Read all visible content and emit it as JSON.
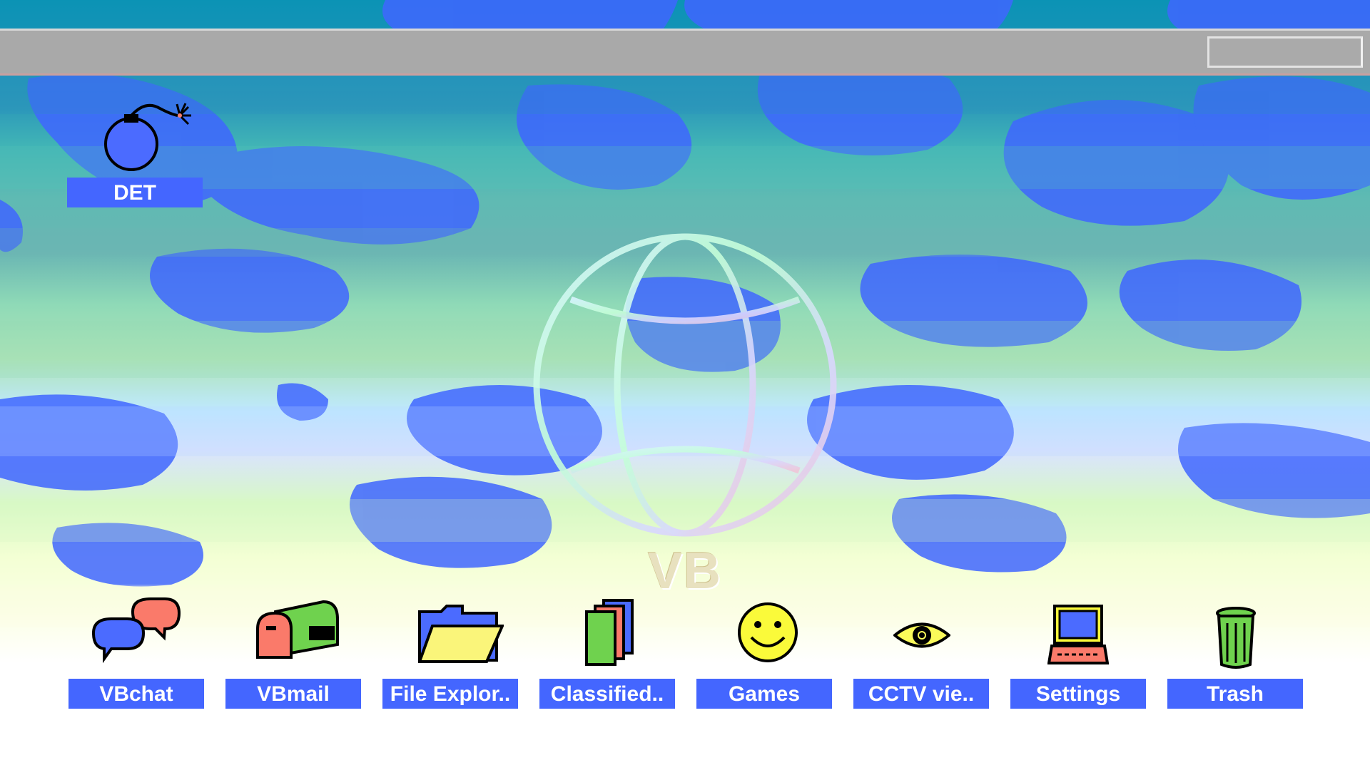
{
  "desktop_icons": [
    {
      "label": "DET",
      "icon": "bomb-icon"
    }
  ],
  "watermark": {
    "text": "VB",
    "icon": "globe-icon"
  },
  "dock": [
    {
      "label": "VBchat",
      "icon": "chat-bubbles-icon"
    },
    {
      "label": "VBmail",
      "icon": "mailbox-icon"
    },
    {
      "label": "File Explor..",
      "icon": "folder-icon"
    },
    {
      "label": "Classified..",
      "icon": "documents-icon"
    },
    {
      "label": "Games",
      "icon": "smiley-icon"
    },
    {
      "label": "CCTV vie..",
      "icon": "eye-icon"
    },
    {
      "label": "Settings",
      "icon": "computer-icon"
    },
    {
      "label": "Trash",
      "icon": "trash-can-icon"
    }
  ],
  "colors": {
    "label_bg": "#4466ff",
    "taskbar": "#a9a9a9",
    "label_text": "#ffffff"
  }
}
